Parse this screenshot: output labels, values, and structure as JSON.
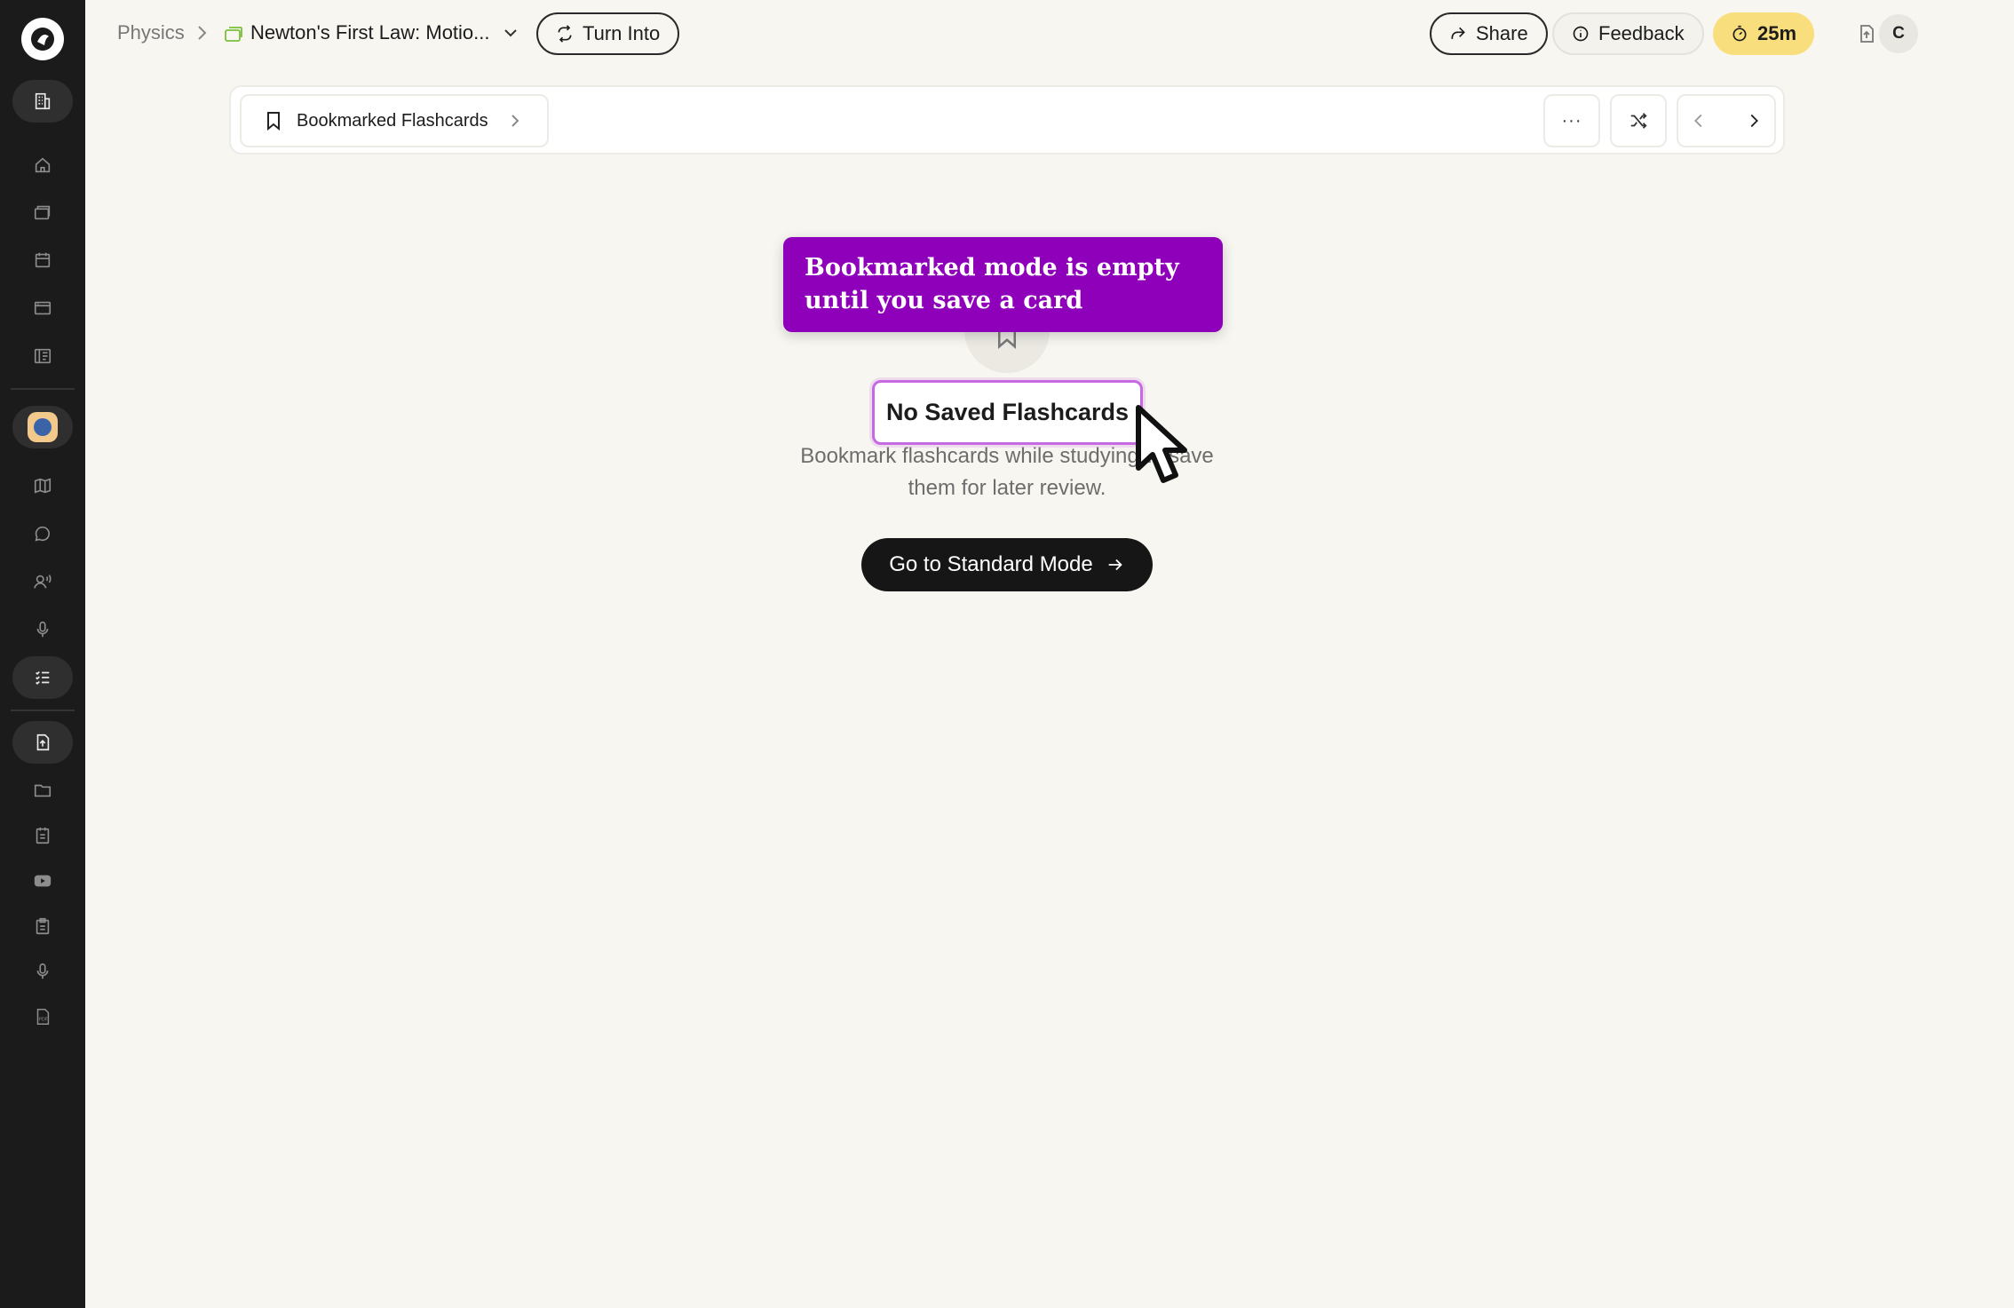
{
  "breadcrumb": {
    "root": "Physics",
    "document": "Newton's First Law: Motio..."
  },
  "header": {
    "turn_into_label": "Turn Into",
    "share_label": "Share",
    "feedback_label": "Feedback",
    "timer_label": "25m",
    "avatar_initial": "C"
  },
  "toolbar": {
    "deck_label": "Bookmarked Flashcards",
    "more_label": "···"
  },
  "callout": {
    "text": "Bookmarked mode is empty until you save a card"
  },
  "empty_state": {
    "title": "No Saved Flashcards",
    "description": "Bookmark flashcards while studying to save them for later review.",
    "cta_label": "Go to Standard Mode"
  },
  "sidebar": {
    "items": [
      "building-icon",
      "home-icon",
      "folders-icon",
      "calendar-icon",
      "browser-icon",
      "library-icon",
      "project-icon",
      "map-icon",
      "chat-icon",
      "voice-tutor-icon",
      "microphone-icon",
      "checklist-icon",
      "upload-file-icon",
      "folder-icon",
      "notes-icon",
      "youtube-icon",
      "clipboard-icon",
      "mic-icon",
      "pdf-icon"
    ]
  },
  "colors": {
    "callout_bg": "#8e00b9",
    "timer_bg": "#f9de7d",
    "sidebar_bg": "#1b1b1b",
    "page_bg": "#f7f6f0",
    "highlight_border": "#c66ae3"
  }
}
